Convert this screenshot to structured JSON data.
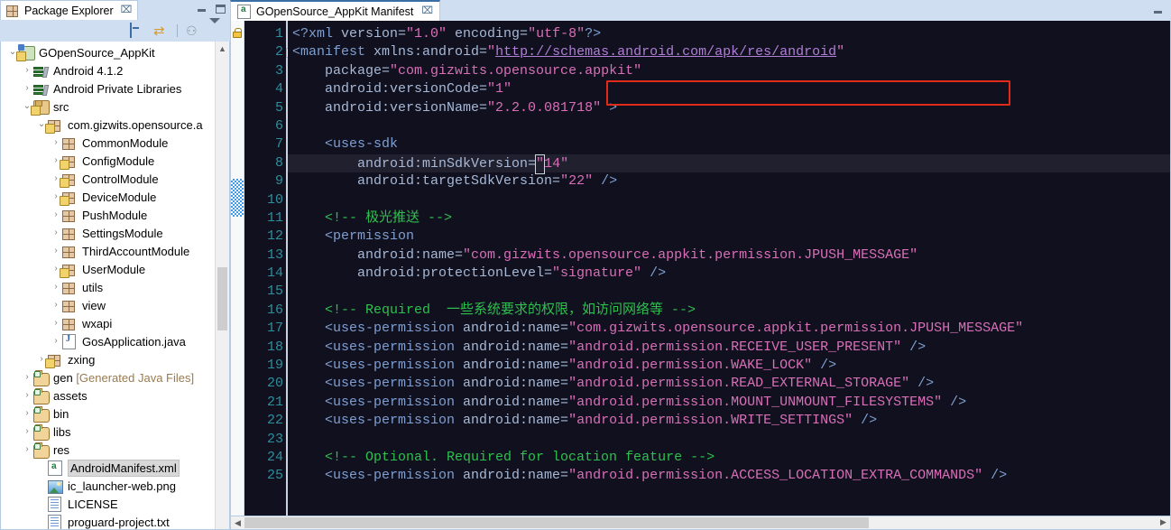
{
  "explorer": {
    "tab_label": "Package Explorer",
    "tab_close": "⌧",
    "window_buttons": {
      "minimize": "minimize-icon",
      "maximize": "maximize-icon"
    },
    "toolbar": {
      "collapse_all": "collapse-all-icon",
      "link_with_editor": "link-with-editor-icon",
      "focus_on_active_task": "focus-task-icon",
      "view_menu": "view-menu-icon"
    },
    "tree": [
      {
        "label": "GOpenSource_AppKit",
        "indent": 0,
        "twisty": "⌄",
        "icon": "project",
        "warn": true,
        "selected": false
      },
      {
        "label": "Android 4.1.2",
        "indent": 1,
        "twisty": "›",
        "icon": "library",
        "warn": false,
        "selected": false
      },
      {
        "label": "Android Private Libraries",
        "indent": 1,
        "twisty": "›",
        "icon": "library",
        "warn": false,
        "selected": false
      },
      {
        "label": "src",
        "indent": 1,
        "twisty": "⌄",
        "icon": "srcfolder",
        "warn": true,
        "selected": false
      },
      {
        "label": "com.gizwits.opensource.a",
        "indent": 2,
        "twisty": "⌄",
        "icon": "package",
        "warn": true,
        "selected": false
      },
      {
        "label": "CommonModule",
        "indent": 3,
        "twisty": "›",
        "icon": "package",
        "warn": false,
        "selected": false
      },
      {
        "label": "ConfigModule",
        "indent": 3,
        "twisty": "›",
        "icon": "package",
        "warn": true,
        "selected": false
      },
      {
        "label": "ControlModule",
        "indent": 3,
        "twisty": "›",
        "icon": "package",
        "warn": true,
        "selected": false
      },
      {
        "label": "DeviceModule",
        "indent": 3,
        "twisty": "›",
        "icon": "package",
        "warn": true,
        "selected": false
      },
      {
        "label": "PushModule",
        "indent": 3,
        "twisty": "›",
        "icon": "package",
        "warn": false,
        "selected": false
      },
      {
        "label": "SettingsModule",
        "indent": 3,
        "twisty": "›",
        "icon": "package",
        "warn": false,
        "selected": false
      },
      {
        "label": "ThirdAccountModule",
        "indent": 3,
        "twisty": "›",
        "icon": "package",
        "warn": false,
        "selected": false
      },
      {
        "label": "UserModule",
        "indent": 3,
        "twisty": "›",
        "icon": "package",
        "warn": true,
        "selected": false
      },
      {
        "label": "utils",
        "indent": 3,
        "twisty": "›",
        "icon": "package",
        "warn": false,
        "selected": false
      },
      {
        "label": "view",
        "indent": 3,
        "twisty": "›",
        "icon": "package",
        "warn": false,
        "selected": false
      },
      {
        "label": "wxapi",
        "indent": 3,
        "twisty": "›",
        "icon": "package",
        "warn": false,
        "selected": false
      },
      {
        "label": "GosApplication.java",
        "indent": 3,
        "twisty": "›",
        "icon": "java",
        "warn": false,
        "selected": false
      },
      {
        "label": "zxing",
        "indent": 2,
        "twisty": "›",
        "icon": "package",
        "warn": true,
        "selected": false
      },
      {
        "label": "gen ",
        "suffix": "[Generated Java Files]",
        "indent": 1,
        "twisty": "›",
        "icon": "folder",
        "warn": false,
        "selected": false
      },
      {
        "label": "assets",
        "indent": 1,
        "twisty": "›",
        "icon": "folder",
        "warn": false,
        "selected": false
      },
      {
        "label": "bin",
        "indent": 1,
        "twisty": "›",
        "icon": "folder",
        "warn": false,
        "selected": false
      },
      {
        "label": "libs",
        "indent": 1,
        "twisty": "›",
        "icon": "folder",
        "warn": false,
        "selected": false
      },
      {
        "label": "res",
        "indent": 1,
        "twisty": "›",
        "icon": "folder",
        "warn": false,
        "selected": false
      },
      {
        "label": "AndroidManifest.xml",
        "indent": 2,
        "twisty": "",
        "icon": "xml",
        "warn": false,
        "selected": true
      },
      {
        "label": "ic_launcher-web.png",
        "indent": 2,
        "twisty": "",
        "icon": "png",
        "warn": false,
        "selected": false
      },
      {
        "label": "LICENSE",
        "indent": 2,
        "twisty": "",
        "icon": "text",
        "warn": false,
        "selected": false
      },
      {
        "label": "proguard-project.txt",
        "indent": 2,
        "twisty": "",
        "icon": "text",
        "warn": false,
        "selected": false
      }
    ]
  },
  "editor": {
    "tab_label": "GOpenSource_AppKit Manifest",
    "tab_close": "⌧",
    "tab_icon": "xml-file-icon",
    "minimize": "minimize-icon",
    "annotation_lock": "lock-icon",
    "current_line": 8,
    "first_line": 1,
    "last_line": 25,
    "line_numbers": [
      1,
      2,
      3,
      4,
      5,
      6,
      7,
      8,
      9,
      10,
      11,
      12,
      13,
      14,
      15,
      16,
      17,
      18,
      19,
      20,
      21,
      22,
      23,
      24,
      25
    ],
    "fold_marker_line": 2,
    "highlight_box": {
      "color": "#e02a1a",
      "target_line": 3,
      "text": "package=\"com.gizwits.opensource.appkit\""
    },
    "lines": [
      {
        "n": 1,
        "segments": [
          {
            "t": "<?xml ",
            "c": "tag"
          },
          {
            "t": "version=",
            "c": "attr"
          },
          {
            "t": "\"1.0\"",
            "c": "str"
          },
          {
            "t": " encoding=",
            "c": "attr"
          },
          {
            "t": "\"utf-8\"",
            "c": "str"
          },
          {
            "t": "?>",
            "c": "tag"
          }
        ]
      },
      {
        "n": 2,
        "segments": [
          {
            "t": "<manifest ",
            "c": "tag"
          },
          {
            "t": "xmlns:android=",
            "c": "attr"
          },
          {
            "t": "\"",
            "c": "str"
          },
          {
            "t": "http://schemas.android.com/apk/res/android",
            "c": "url"
          },
          {
            "t": "\"",
            "c": "str"
          }
        ]
      },
      {
        "n": 3,
        "segments": [
          {
            "t": "    package=",
            "c": "attr"
          },
          {
            "t": "\"com.gizwits.opensource.appkit\"",
            "c": "str"
          }
        ]
      },
      {
        "n": 4,
        "segments": [
          {
            "t": "    android:versionCode=",
            "c": "attr"
          },
          {
            "t": "\"1\"",
            "c": "str"
          }
        ]
      },
      {
        "n": 5,
        "segments": [
          {
            "t": "    android:versionName=",
            "c": "attr"
          },
          {
            "t": "\"2.2.0.081718\"",
            "c": "str"
          },
          {
            "t": " >",
            "c": "tag"
          }
        ]
      },
      {
        "n": 6,
        "segments": []
      },
      {
        "n": 7,
        "segments": [
          {
            "t": "    <uses-sdk",
            "c": "tag"
          }
        ]
      },
      {
        "n": 8,
        "segments": [
          {
            "t": "        android:minSdkVersion=",
            "c": "attr"
          },
          {
            "t": "\"",
            "c": "cursor"
          },
          {
            "t": "14\"",
            "c": "str"
          }
        ]
      },
      {
        "n": 9,
        "segments": [
          {
            "t": "        android:targetSdkVersion=",
            "c": "attr"
          },
          {
            "t": "\"22\"",
            "c": "str"
          },
          {
            "t": " />",
            "c": "tag"
          }
        ]
      },
      {
        "n": 10,
        "segments": []
      },
      {
        "n": 11,
        "segments": [
          {
            "t": "    <!-- 极光推送 -->",
            "c": "cmt"
          }
        ]
      },
      {
        "n": 12,
        "segments": [
          {
            "t": "    <permission",
            "c": "tag"
          }
        ]
      },
      {
        "n": 13,
        "segments": [
          {
            "t": "        android:name=",
            "c": "attr"
          },
          {
            "t": "\"com.gizwits.opensource.appkit.permission.JPUSH_MESSAGE\"",
            "c": "str"
          }
        ]
      },
      {
        "n": 14,
        "segments": [
          {
            "t": "        android:protectionLevel=",
            "c": "attr"
          },
          {
            "t": "\"signature\"",
            "c": "str"
          },
          {
            "t": " />",
            "c": "tag"
          }
        ]
      },
      {
        "n": 15,
        "segments": []
      },
      {
        "n": 16,
        "segments": [
          {
            "t": "    <!-- Required  一些系统要求的权限，如访问网络等 -->",
            "c": "cmt"
          }
        ]
      },
      {
        "n": 17,
        "segments": [
          {
            "t": "    <uses-permission ",
            "c": "tag"
          },
          {
            "t": "android:name=",
            "c": "attr"
          },
          {
            "t": "\"com.gizwits.opensource.appkit.permission.JPUSH_MESSAGE\"",
            "c": "str"
          }
        ]
      },
      {
        "n": 18,
        "segments": [
          {
            "t": "    <uses-permission ",
            "c": "tag"
          },
          {
            "t": "android:name=",
            "c": "attr"
          },
          {
            "t": "\"android.permission.RECEIVE_USER_PRESENT\"",
            "c": "str"
          },
          {
            "t": " />",
            "c": "tag"
          }
        ]
      },
      {
        "n": 19,
        "segments": [
          {
            "t": "    <uses-permission ",
            "c": "tag"
          },
          {
            "t": "android:name=",
            "c": "attr"
          },
          {
            "t": "\"android.permission.WAKE_LOCK\"",
            "c": "str"
          },
          {
            "t": " />",
            "c": "tag"
          }
        ]
      },
      {
        "n": 20,
        "segments": [
          {
            "t": "    <uses-permission ",
            "c": "tag"
          },
          {
            "t": "android:name=",
            "c": "attr"
          },
          {
            "t": "\"android.permission.READ_EXTERNAL_STORAGE\"",
            "c": "str"
          },
          {
            "t": " />",
            "c": "tag"
          }
        ]
      },
      {
        "n": 21,
        "segments": [
          {
            "t": "    <uses-permission ",
            "c": "tag"
          },
          {
            "t": "android:name=",
            "c": "attr"
          },
          {
            "t": "\"android.permission.MOUNT_UNMOUNT_FILESYSTEMS\"",
            "c": "str"
          },
          {
            "t": " />",
            "c": "tag"
          }
        ]
      },
      {
        "n": 22,
        "segments": [
          {
            "t": "    <uses-permission ",
            "c": "tag"
          },
          {
            "t": "android:name=",
            "c": "attr"
          },
          {
            "t": "\"android.permission.WRITE_SETTINGS\"",
            "c": "str"
          },
          {
            "t": " />",
            "c": "tag"
          }
        ]
      },
      {
        "n": 23,
        "segments": []
      },
      {
        "n": 24,
        "segments": [
          {
            "t": "    <!-- Optional. Required for location feature -->",
            "c": "cmt"
          }
        ]
      },
      {
        "n": 25,
        "segments": [
          {
            "t": "    <uses-permission ",
            "c": "tag"
          },
          {
            "t": "android:name=",
            "c": "attr"
          },
          {
            "t": "\"android.permission.ACCESS_LOCATION_EXTRA_COMMANDS\"",
            "c": "str"
          },
          {
            "t": " />",
            "c": "tag"
          }
        ]
      }
    ]
  },
  "colors": {
    "editor_bg": "#10101e",
    "current_line_bg": "#20202f",
    "line_number": "#2d8f9e",
    "tag": "#7f9fd1",
    "attribute": "#a7b9d6",
    "string": "#d96fb8",
    "comment": "#2ec04e",
    "url": "#b07fd6",
    "annotation_box": "#e02a1a",
    "chrome_bg": "#cfdef0",
    "diff_marker": "#3d9ae8"
  },
  "scrollbars": {
    "tree_up": "▲",
    "tree_down": "▼",
    "editor_left": "◀",
    "editor_right": "▶"
  }
}
